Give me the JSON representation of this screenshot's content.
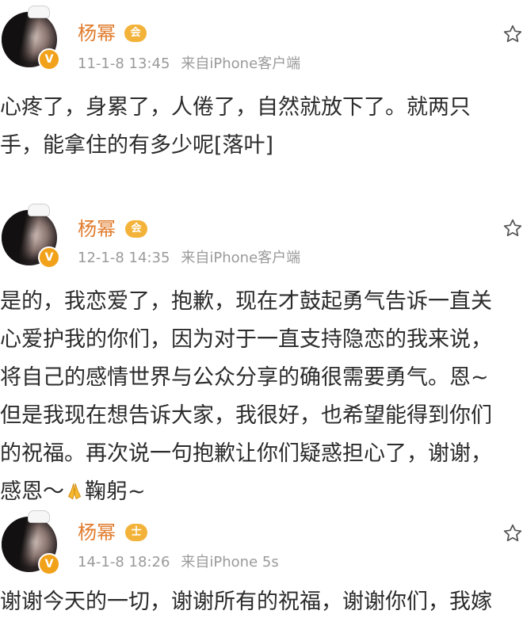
{
  "posts": [
    {
      "author": "杨幂",
      "time": "11-1-8 13:45",
      "source": "来自iPhone客户端",
      "badge": "V",
      "vip_label": "会",
      "lines": [
        "心疼了，身累了，人倦了，自然就放下了。就两只",
        "手，能拿住的有多少呢[落叶]"
      ]
    },
    {
      "author": "杨幂",
      "time": "12-1-8 14:35",
      "source": "来自iPhone客户端",
      "badge": "V",
      "vip_label": "会",
      "lines": [
        "是的，我恋爱了，抱歉，现在才鼓起勇气告诉一直关",
        "心爱护我的你们，因为对于一直支持隐恋的我来说，",
        "将自己的感情世界与公众分享的确很需要勇气。恩~",
        "但是我现在想告诉大家，我很好，也希望能得到你们",
        "的祝福。再次说一句抱歉让你们疑惑担心了，谢谢，"
      ],
      "last_line_before": "感恩～",
      "last_line_emoji": "pray-emoji",
      "last_line_after": "鞠躬~"
    },
    {
      "author": "杨幂",
      "time": "14-1-8 18:26",
      "source": "来自iPhone 5s",
      "badge": "V",
      "vip_label": "士",
      "lines": [
        "谢谢今天的一切，谢谢所有的祝福，谢谢你们，我嫁"
      ]
    }
  ],
  "icons": {
    "favorite": "star-outline-icon",
    "verified": "verified-badge-icon"
  },
  "colors": {
    "name": "#e07c2e",
    "meta": "#9a9a9a",
    "text": "#2b2b2b",
    "badge": "#f2a21a",
    "vip": "#f3b33a"
  }
}
